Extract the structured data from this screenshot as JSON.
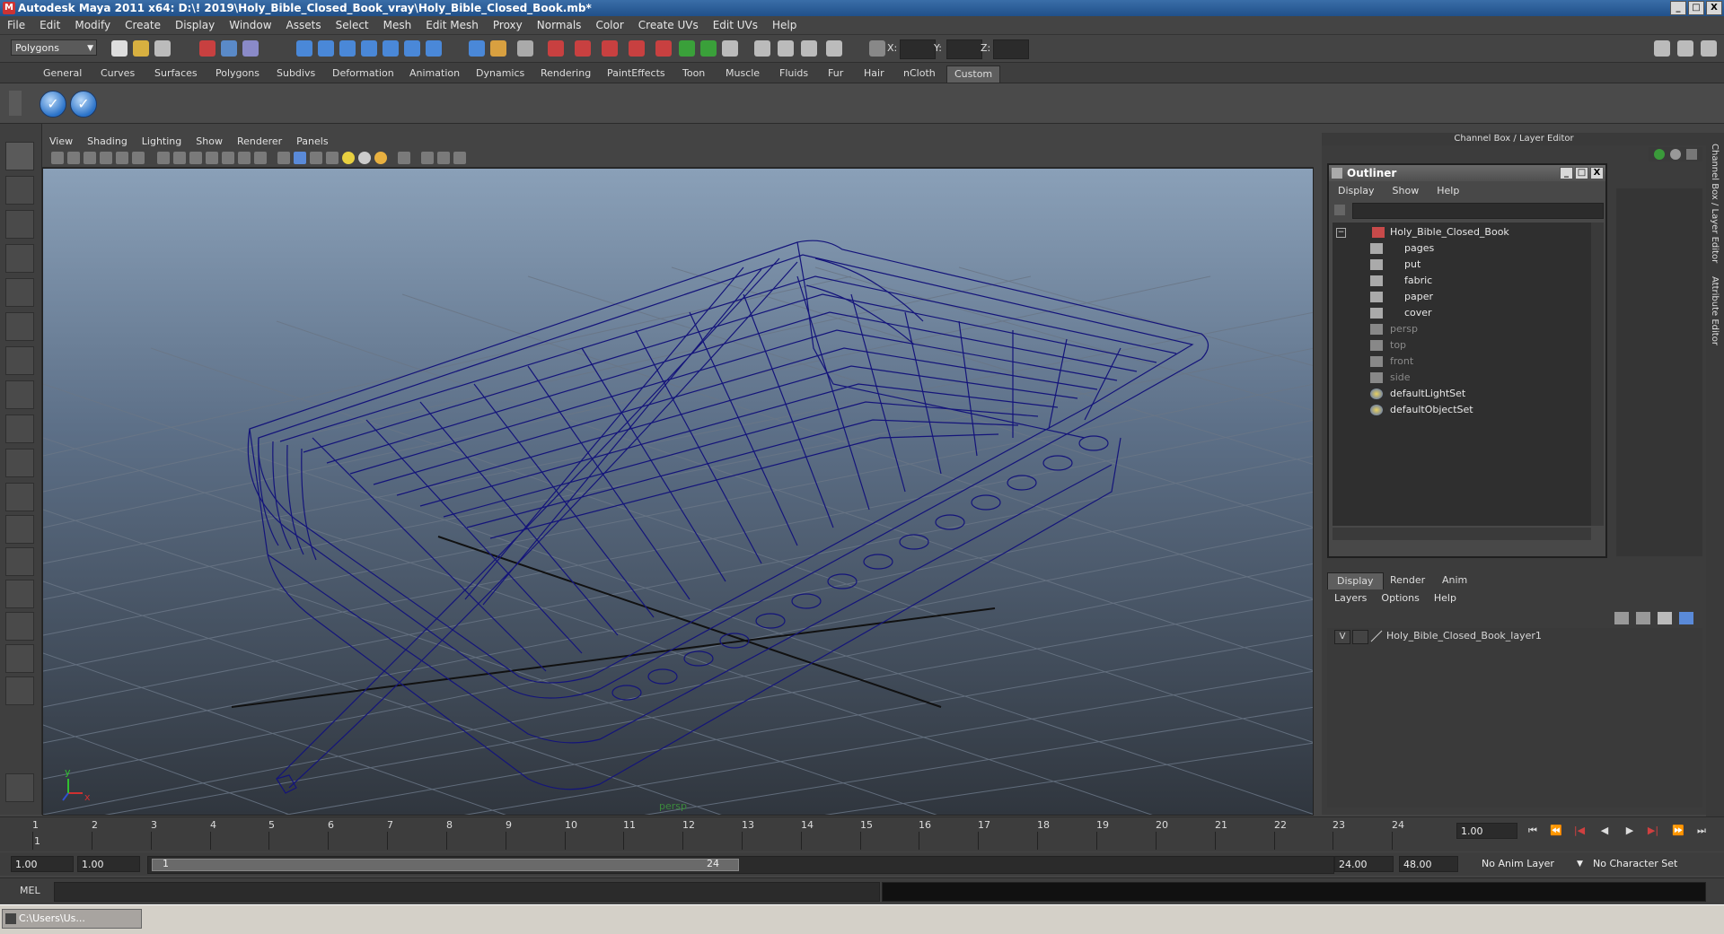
{
  "window": {
    "title": "Autodesk Maya 2011 x64: D:\\! 2019\\Holy_Bible_Closed_Book_vray\\Holy_Bible_Closed_Book.mb*",
    "buttons": [
      "_",
      "□",
      "X"
    ]
  },
  "menubar": [
    "File",
    "Edit",
    "Modify",
    "Create",
    "Display",
    "Window",
    "Assets",
    "Select",
    "Mesh",
    "Edit Mesh",
    "Proxy",
    "Normals",
    "Color",
    "Create UVs",
    "Edit UVs",
    "Help"
  ],
  "statusline": {
    "mode": "Polygons",
    "x_label": "X:",
    "y_label": "Y:",
    "z_label": "Z:"
  },
  "shelf": {
    "tabs": [
      "General",
      "Curves",
      "Surfaces",
      "Polygons",
      "Subdivs",
      "Deformation",
      "Animation",
      "Dynamics",
      "Rendering",
      "PaintEffects",
      "Toon",
      "Muscle",
      "Fluids",
      "Fur",
      "Hair",
      "nCloth",
      "Custom"
    ],
    "active_tab": "Custom"
  },
  "viewport": {
    "menu": [
      "View",
      "Shading",
      "Lighting",
      "Show",
      "Renderer",
      "Panels"
    ],
    "camera_label": "persp",
    "axis_x": "x",
    "axis_y": "y"
  },
  "channel_box": {
    "header": "Channel Box / Layer Editor",
    "side_tabs": [
      "Channel Box / Layer Editor",
      "Attribute Editor"
    ]
  },
  "outliner": {
    "title": "Outliner",
    "menu": [
      "Display",
      "Show",
      "Help"
    ],
    "items": [
      {
        "label": "Holy_Bible_Closed_Book",
        "level": 0,
        "dim": false
      },
      {
        "label": "pages",
        "level": 1,
        "dim": false
      },
      {
        "label": "put",
        "level": 1,
        "dim": false
      },
      {
        "label": "fabric",
        "level": 1,
        "dim": false
      },
      {
        "label": "paper",
        "level": 1,
        "dim": false
      },
      {
        "label": "cover",
        "level": 1,
        "dim": false
      },
      {
        "label": "persp",
        "level": 0,
        "dim": true
      },
      {
        "label": "top",
        "level": 0,
        "dim": true
      },
      {
        "label": "front",
        "level": 0,
        "dim": true
      },
      {
        "label": "side",
        "level": 0,
        "dim": true
      },
      {
        "label": "defaultLightSet",
        "level": 0,
        "dim": false
      },
      {
        "label": "defaultObjectSet",
        "level": 0,
        "dim": false
      }
    ]
  },
  "layer_editor": {
    "tabs": [
      "Display",
      "Render",
      "Anim"
    ],
    "menu": [
      "Layers",
      "Options",
      "Help"
    ],
    "layers": [
      {
        "visible": "V",
        "name": "Holy_Bible_Closed_Book_layer1"
      }
    ]
  },
  "timeslider": {
    "ticks": [
      "1",
      "2",
      "3",
      "4",
      "5",
      "6",
      "7",
      "8",
      "9",
      "10",
      "11",
      "12",
      "13",
      "14",
      "15",
      "16",
      "17",
      "18",
      "19",
      "20",
      "21",
      "22",
      "23",
      "24"
    ],
    "current_frame": "1.00",
    "current_marker": "1"
  },
  "rangeslider": {
    "start": "1.00",
    "anim_start": "1.00",
    "range_start": "1",
    "range_end": "24",
    "anim_end": "24.00",
    "end": "48.00",
    "anim_layer": "No Anim Layer",
    "character_set": "No Character Set"
  },
  "commandline": {
    "label": "MEL"
  },
  "taskbar": {
    "task": "C:\\Users\\Us..."
  },
  "colors": {
    "wireframe": "#14147a",
    "titlebar": "#2a5a96",
    "grid": "#6a7686"
  }
}
